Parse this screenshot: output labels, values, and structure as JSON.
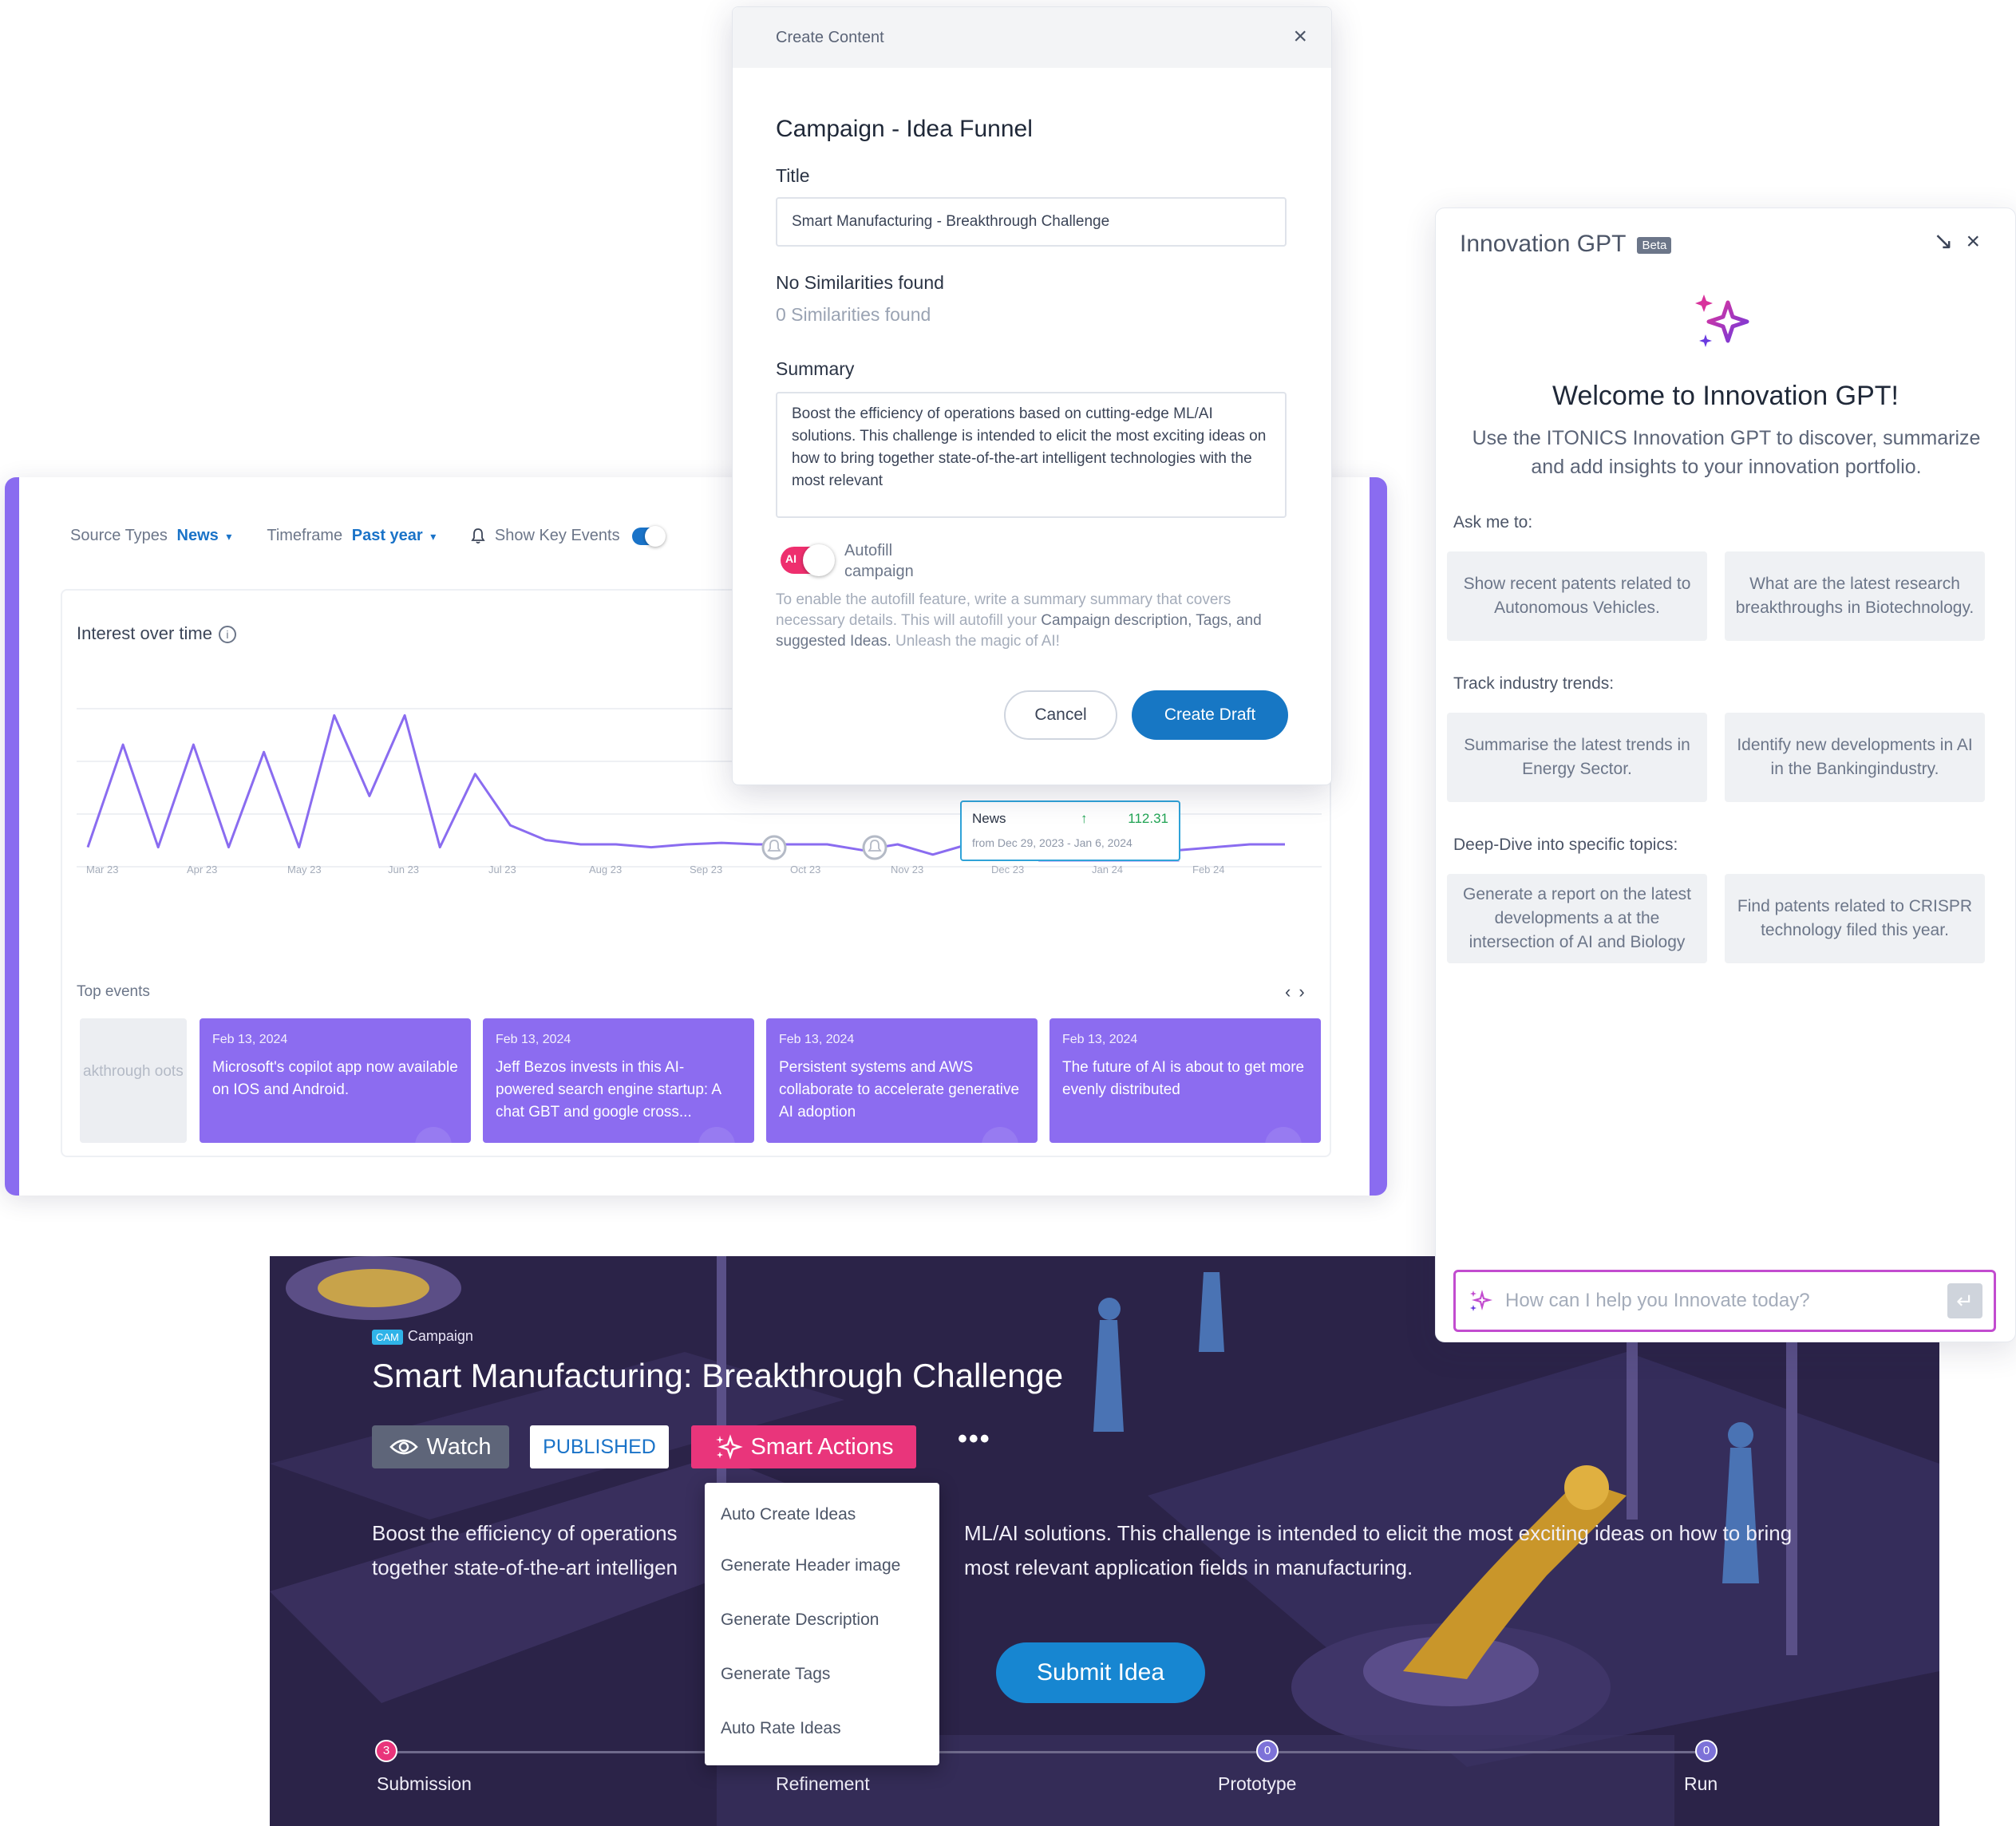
{
  "analytics": {
    "filters": {
      "source_label": "Source Types",
      "source_value": "News",
      "timeframe_label": "Timeframe",
      "timeframe_value": "Past year",
      "key_events_label": "Show Key Events",
      "key_events_on": true
    },
    "interest_title": "Interest over time",
    "tooltip": {
      "series": "News",
      "value": "112.31",
      "range": "from Dec 29, 2023 - Jan 6, 2024"
    },
    "x_labels": [
      "Mar 23",
      "Apr 23",
      "May 23",
      "Jun 23",
      "Jul 23",
      "Aug 23",
      "Sep 23",
      "Oct 23",
      "Nov 23",
      "Dec 23",
      "Jan 24",
      "Feb 24"
    ],
    "top_events_label": "Top events",
    "ghost_event_text": "akthrough oots",
    "events": [
      {
        "date": "Feb 13, 2024",
        "text": "Microsoft's copilot app now available on IOS and Android."
      },
      {
        "date": "Feb 13, 2024",
        "text": "Jeff Bezos invests in this AI-powered search engine startup: A chat GBT and google cross..."
      },
      {
        "date": "Feb 13, 2024",
        "text": "Persistent systems and AWS collaborate to accelerate generative AI adoption"
      },
      {
        "date": "Feb 13, 2024",
        "text": "The future of AI is about to get more evenly distributed"
      }
    ]
  },
  "chart_data": {
    "type": "line",
    "title": "Interest over time",
    "x": [
      "Mar 23",
      "Apr 23",
      "May 23",
      "Jun 23",
      "Jul 23",
      "Aug 23",
      "Sep 23",
      "Oct 23",
      "Nov 23",
      "Dec 23",
      "Jan 24",
      "Feb 24"
    ],
    "series": [
      {
        "name": "News",
        "values": [
          10,
          80,
          10,
          80,
          10,
          75,
          10,
          100,
          45,
          100,
          10,
          60,
          25,
          15,
          12,
          12,
          10,
          12,
          13,
          12,
          12,
          12,
          8,
          12,
          5,
          12,
          4,
          10,
          20,
          30,
          12,
          8,
          10,
          12,
          12
        ]
      }
    ],
    "highlight": {
      "label": "News",
      "value": 112.31,
      "range": "Dec 29, 2023 - Jan 6, 2024"
    },
    "key_event_markers": [
      "Oct 23",
      "Nov 23",
      "Jan 24"
    ],
    "grid": true
  },
  "modal": {
    "header": "Create Content",
    "heading": "Campaign - Idea Funnel",
    "title_label": "Title",
    "title_value": "Smart Manufacturing - Breakthrough Challenge",
    "similarities_heading": "No Similarities found",
    "similarities_count": "0 Similarities found",
    "summary_label": "Summary",
    "summary_value": "Boost the efficiency of operations based on cutting-edge ML/AI solutions. This challenge is intended to elicit the most exciting ideas on how to bring together state-of-the-art intelligent technologies with the most relevant",
    "autofill_label": "Autofill campaign",
    "autofill_on": true,
    "autofill_help_1": "To enable the autofill feature, write a summary summary that covers necessary details. This will autofill your ",
    "autofill_help_accent": "Campaign description, Tags, and suggested Ideas.",
    "autofill_help_2": " Unleash the magic of AI!",
    "cancel_label": "Cancel",
    "create_label": "Create Draft"
  },
  "gpt": {
    "title": "Innovation GPT",
    "beta": "Beta",
    "welcome": "Welcome to Innovation GPT!",
    "intro": "Use the ITONICS Innovation GPT to discover, summarize and add insights to your innovation portfolio.",
    "ask_label": "Ask me to:",
    "ask_items": [
      "Show recent patents related to Autonomous Vehicles.",
      "What are the latest research breakthroughs in Biotechnology."
    ],
    "track_label": "Track industry trends:",
    "track_items": [
      "Summarise the latest trends in Energy Sector.",
      "Identify new developments in AI in the Bankingindustry."
    ],
    "deep_label": "Deep-Dive into specific topics:",
    "deep_items": [
      "Generate a report on the latest developments a at the intersection of AI and Biology",
      "Find patents related to CRISPR technology filed this year."
    ],
    "input_placeholder": "How can I help you Innovate today?"
  },
  "campaign": {
    "type_badge": "CAM",
    "type_label": "Campaign",
    "title": "Smart Manufacturing: Breakthrough Challenge",
    "watch_label": "Watch",
    "status": "PUBLISHED",
    "smart_actions_label": "Smart Actions",
    "more_label": "•••",
    "description_left": "Boost the efficiency of operations",
    "description_right": "ML/AI solutions. This challenge is intended to elicit the most exciting ideas on how to bring",
    "description_left2": "together state-of-the-art intelligen",
    "description_right2": "most relevant application fields in manufacturing.",
    "submit_label": "Submit Idea",
    "stages": [
      {
        "label": "Submission",
        "count": "3"
      },
      {
        "label": "Refinement",
        "count": ""
      },
      {
        "label": "Prototype",
        "count": "0"
      },
      {
        "label": "Run",
        "count": "0"
      }
    ],
    "smart_menu": [
      "Auto Create Ideas",
      "Generate Header image",
      "Generate Description",
      "Generate Tags",
      "Auto Rate Ideas"
    ]
  },
  "colors": {
    "accent_purple": "#8a6cf0",
    "primary_blue": "#1777c4",
    "smart_pink": "#e9357b",
    "banner_bg": "#2b2348",
    "gpt_input_border": "#c24ccf"
  }
}
